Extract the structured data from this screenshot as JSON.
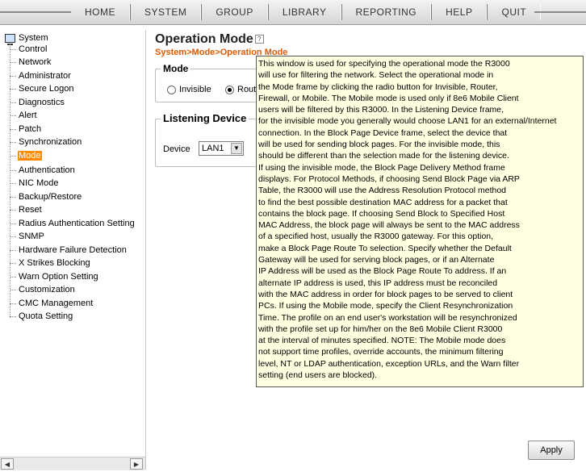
{
  "nav": {
    "items": [
      "HOME",
      "SYSTEM",
      "GROUP",
      "LIBRARY",
      "REPORTING",
      "HELP",
      "QUIT"
    ]
  },
  "sidebar": {
    "root": "System",
    "items": [
      "Control",
      "Network",
      "Administrator",
      "Secure Logon",
      "Diagnostics",
      "Alert",
      "Patch",
      "Synchronization",
      "Mode",
      "Authentication",
      "NIC Mode",
      "Backup/Restore",
      "Reset",
      "Radius Authentication Setting",
      "SNMP",
      "Hardware Failure Detection",
      "X Strikes Blocking",
      "Warn Option Setting",
      "Customization",
      "CMC Management",
      "Quota Setting"
    ],
    "selected": "Mode",
    "scroll_left": "◀",
    "scroll_right": "▶"
  },
  "main": {
    "title": "Operation Mode",
    "help_icon": "?",
    "breadcrumb": "System>Mode>Operation Mode",
    "mode_section": {
      "legend": "Mode",
      "options": [
        {
          "label": "Invisible",
          "checked": false
        },
        {
          "label": "Rout",
          "checked": true
        }
      ]
    },
    "listening_section": {
      "legend": "Listening Device",
      "device_label": "Device",
      "device_value": "LAN1",
      "dropdown_arrow": "▼"
    },
    "apply_label": "Apply"
  },
  "tooltip": {
    "lines": [
      "This window is used for specifying the operational mode the R3000",
      "will use for filtering the network. Select the operational mode in",
      "the Mode frame by clicking the radio button for Invisible, Router,",
      "Firewall, or Mobile. The Mobile mode is used only if 8e6 Mobile Client",
      "users will be filtered by this R3000. In the Listening Device frame,",
      "for the invisible mode you generally would choose LAN1 for an external/Internet",
      "connection. In the Block Page Device frame, select the device that",
      "will be used for sending block pages. For the invisible mode, this",
      "should be different than the selection made for the listening device.",
      "If using the invisible mode, the Block Page Delivery Method frame",
      "displays. For Protocol Methods, if choosing Send Block Page via ARP",
      "Table, the R3000 will use the Address Resolution Protocol method",
      "to find the best possible destination MAC address for a packet that",
      "contains the block page. If choosing Send Block to Specified Host",
      "MAC Address, the block page will always be sent to the MAC address",
      "of a specified host, usually the R3000 gateway. For this option,",
      "make a Block Page Route To selection. Specify whether the Default",
      "Gateway will be used for serving block pages, or if an Alternate",
      "IP Address will be used as the Block Page Route To address. If an",
      "alternate IP address is used, this IP address must be reconciled",
      "with the MAC address in order for block pages to be served to client",
      "PCs. If using the Mobile mode, specify the Client Resynchronization",
      "Time. The profile on an end user's workstation will be resynchronized",
      "with the profile set up for him/her on the 8e6 Mobile Client R3000",
      "at the interval of minutes specified. NOTE: The Mobile mode does",
      "not support time profiles, override accounts, the minimum filtering",
      "level, NT or LDAP authentication, exception URLs, and the Warn filter",
      "setting (end users are blocked)."
    ]
  }
}
